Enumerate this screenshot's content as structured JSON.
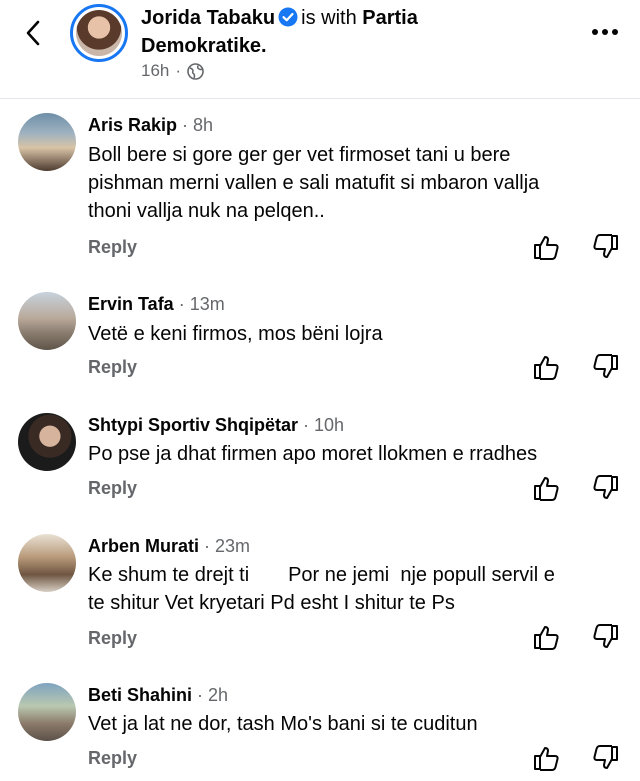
{
  "post": {
    "author": "Jorida Tabaku",
    "with_text": "is with",
    "with_page_first": "Partia",
    "with_page_second": "Demokratike.",
    "time": "16h",
    "dot": "·"
  },
  "icons": {
    "back": "chevron-left-icon",
    "verified": "verified-badge-icon",
    "privacy": "globe-icon",
    "more": "more-options-icon",
    "like": "thumbs-up-icon",
    "dislike": "thumbs-down-icon"
  },
  "colors": {
    "brand": "#1877f2",
    "meta": "#65676b",
    "text": "#050505"
  },
  "comments": [
    {
      "name": "Aris Rakip",
      "time": "8h",
      "text": "Boll bere si gore ger ger vet firmoset tani u bere\npishman merni vallen e sali matufit si mbaron vallja\nthoni vallja nuk na pelqen..",
      "reply": "Reply"
    },
    {
      "name": "Ervin Tafa",
      "time": "13m",
      "text": "Vetë e keni firmos, mos bëni lojra",
      "reply": "Reply"
    },
    {
      "name": "Shtypi Sportiv Shqipëtar",
      "time": "10h",
      "text": "Po pse ja dhat firmen apo moret llokmen e rradhes",
      "reply": "Reply"
    },
    {
      "name": "Arben Murati",
      "time": "23m",
      "text": "Ke shum te drejt ti       Por ne jemi  nje popull servil e\nte shitur Vet kryetari Pd esht I shitur te Ps",
      "reply": "Reply"
    },
    {
      "name": "Beti Shahini",
      "time": "2h",
      "text": "Vet ja lat ne dor, tash Mo's bani si te cuditun",
      "reply": "Reply"
    }
  ]
}
